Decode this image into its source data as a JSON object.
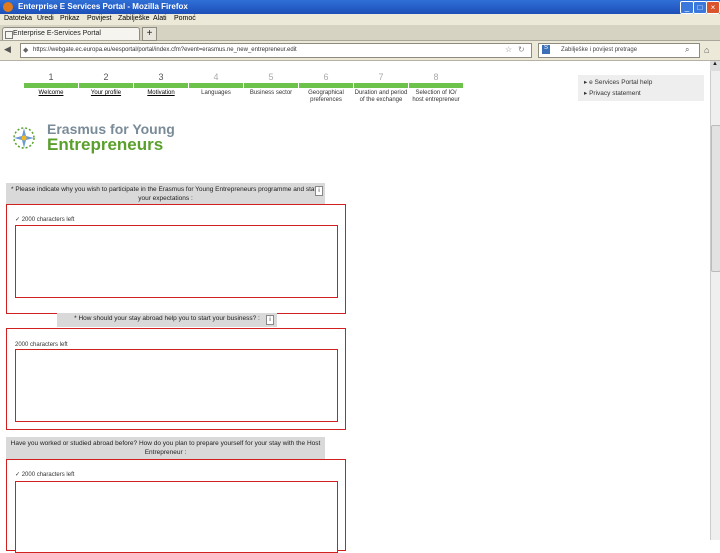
{
  "window": {
    "title": "Enterprise E Services Portal - Mozilla Firefox"
  },
  "menu": [
    "Datoteka",
    "Uredi",
    "Prikaz",
    "Povijest",
    "Zabilješke",
    "Alati",
    "Pomoć"
  ],
  "tabs": [
    {
      "label": "Enterprise E-Services Portal"
    }
  ],
  "navbar": {
    "url": "https://webgate.ec.europa.eu/eesportal/portal/index.cfm?event=erasmus.ne_new_entrepreneur.edit",
    "search_placeholder": "Zabilješke i povijest pretrage"
  },
  "wizard": {
    "steps": [
      {
        "num": "1",
        "label": "Welcome",
        "state": "done"
      },
      {
        "num": "2",
        "label": "Your profile",
        "state": "done"
      },
      {
        "num": "3",
        "label": "Motivation",
        "state": "done"
      },
      {
        "num": "4",
        "label": "Languages",
        "state": "todo"
      },
      {
        "num": "5",
        "label": "Business sector",
        "state": "todo"
      },
      {
        "num": "6",
        "label": "Geographical preferences",
        "state": "todo"
      },
      {
        "num": "7",
        "label": "Duration and period of the exchange",
        "state": "todo"
      },
      {
        "num": "8",
        "label": "Selection of IO/ host entrepreneur",
        "state": "todo"
      }
    ]
  },
  "sidebar": {
    "links": [
      "e Services Portal help",
      "Privacy statement"
    ]
  },
  "logo": {
    "line1": "Erasmus for Young",
    "line2": "Entrepreneurs"
  },
  "questions": [
    {
      "heading": "* Please indicate why you wish to participate in the Erasmus for Young Entrepreneurs programme and state your expectations :",
      "chars": "2000 characters left",
      "value": ""
    },
    {
      "heading": "* How should your stay abroad help you to start your business? :",
      "chars": "2000 characters left",
      "value": ""
    },
    {
      "heading": "Have you worked or studied abroad before? How do you plan to prepare yourself for your stay with the Host Entrepreneur :",
      "chars": "2000 characters left",
      "value": ""
    }
  ],
  "colors": {
    "titlebar": "#1d4fb8",
    "step_bar": "#6cc24a",
    "error_border": "#d02020",
    "logo_green": "#5aa02c",
    "logo_grey": "#7a8b98"
  }
}
